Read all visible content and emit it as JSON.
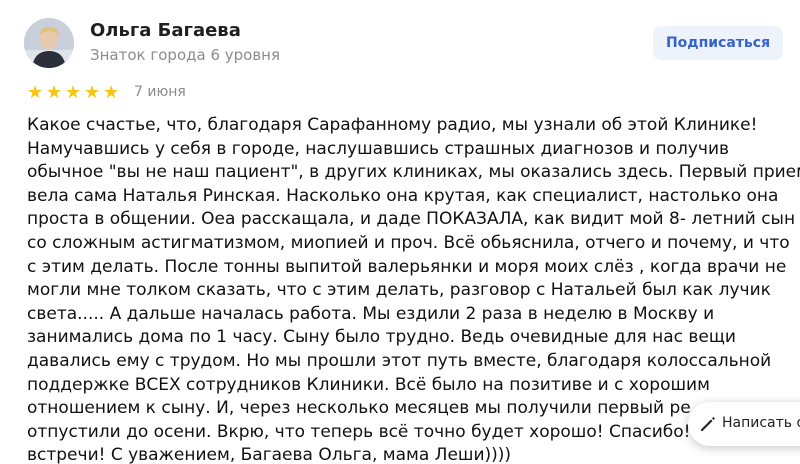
{
  "author": {
    "name": "Ольга Багаева",
    "status": "Знаток города 6 уровня",
    "avatar_icon": "user-photo"
  },
  "subscribe_label": "Подписаться",
  "rating": {
    "value": 5,
    "max": 5,
    "star_color": "#f5c518"
  },
  "review": {
    "date": "7 июня",
    "lines": [
      "Какое счастье, что, благодаря Сарафанному радио, мы узнали об этой Клинике!",
      "Намучавшись у себя в городе, наслушавшись страшных диагнозов и получив",
      "обычное \"вы не наш пациент\", в других клиниках, мы оказались здесь. Первый прием",
      "вела сама Наталья Ринская. Насколько она крутая, как специалист, настолько она",
      "проста в общении. Оеа расскащала, и даде ПОКАЗАЛА, как видит мой 8- летний сын",
      "со сложным астигматизмом, миопией и проч. Всё обьяснила, отчего и почему, и что",
      "с этим делать. После тонны выпитой валерьянки и моря моих слёз , когда врачи не",
      "могли мне толком сказать, что с этим делать, разговор с Натальей был как лучик",
      "света..... А дальше началась работа. Мы ездили 2 раза в неделю в Москву и",
      "занимались дома по 1 часу. Сыну было трудно. Ведь очевидные для нас вещи",
      "давались ему с трудом. Но мы прошли этот путь вместе, благодаря колоссальной",
      "поддержке ВСЕХ сотрудников Клиники. Всё было на позитиве и с хорошим",
      "отношением к сыну. И, через несколько месяцев мы получили первый ре",
      "отпустили до осени. Вкрю, что теперь всё точно будет хорошо! Спасибо!",
      "встречи! С уважением, Багаева Ольга, мама Леши))))"
    ]
  },
  "write_button": {
    "label": "Написать о",
    "icon": "pencil-icon"
  },
  "colors": {
    "accent": "#3563c9",
    "subscribe_bg": "#eef2fb",
    "muted_text": "#8c8c8c"
  }
}
